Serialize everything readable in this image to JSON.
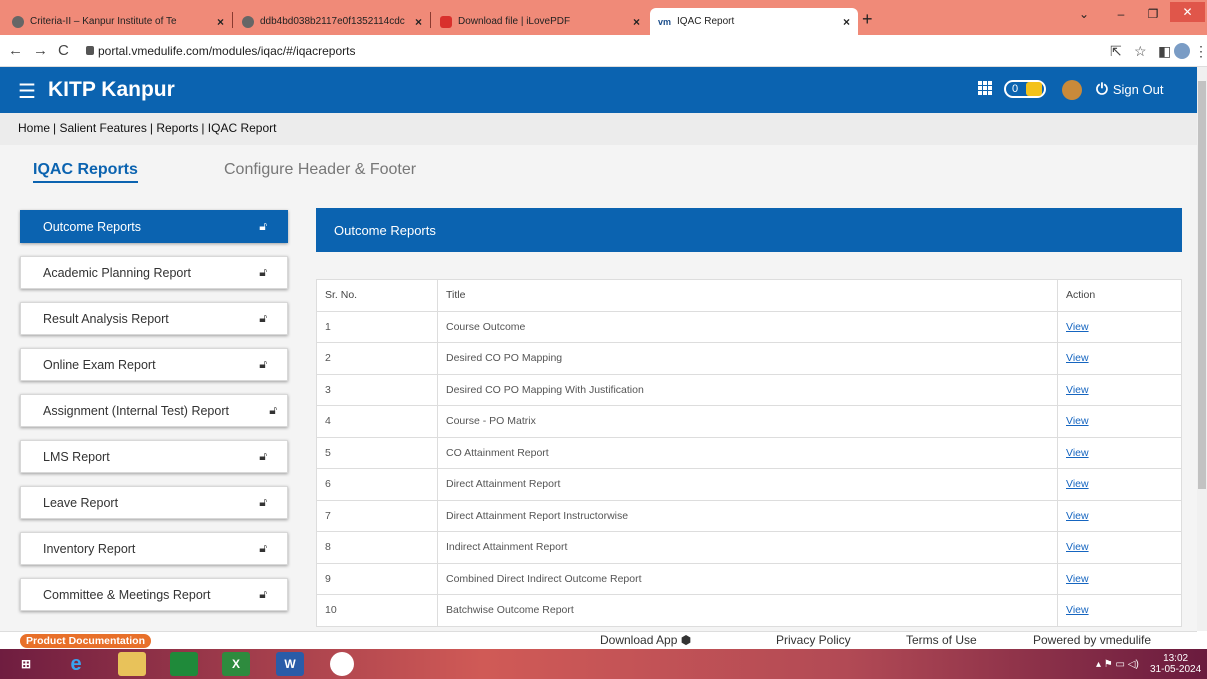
{
  "browser": {
    "tabs": [
      {
        "title": "Criteria-II – Kanpur Institute of Te"
      },
      {
        "title": "ddb4bd038b2117e0f1352114cdc"
      },
      {
        "title": "Download file | iLovePDF"
      },
      {
        "title": "IQAC Report"
      }
    ],
    "url": "portal.vmedulife.com/modules/iqac/#/iqacreports"
  },
  "header": {
    "brand": "KITP Kanpur",
    "trophy_count": "0",
    "signout_label": "Sign Out"
  },
  "breadcrumb": [
    "Home",
    "Salient Features",
    "Reports",
    "IQAC Report"
  ],
  "page_tabs": {
    "active": "IQAC Reports",
    "other": "Configure Header & Footer"
  },
  "menu": [
    {
      "label": "Outcome Reports"
    },
    {
      "label": "Academic Planning Report"
    },
    {
      "label": "Result Analysis Report"
    },
    {
      "label": "Online Exam Report"
    },
    {
      "label": "Assignment (Internal Test) Report"
    },
    {
      "label": "LMS Report"
    },
    {
      "label": "Leave Report"
    },
    {
      "label": "Inventory Report"
    },
    {
      "label": "Committee & Meetings Report"
    }
  ],
  "panel": {
    "title": "Outcome Reports",
    "columns": [
      "Sr. No.",
      "Title",
      "Action"
    ],
    "rows": [
      {
        "no": "1",
        "title": "Course Outcome",
        "action": "View"
      },
      {
        "no": "2",
        "title": "Desired CO PO Mapping",
        "action": "View"
      },
      {
        "no": "3",
        "title": "Desired CO PO Mapping With Justification",
        "action": "View"
      },
      {
        "no": "4",
        "title": "Course - PO Matrix",
        "action": "View"
      },
      {
        "no": "5",
        "title": "CO Attainment Report",
        "action": "View"
      },
      {
        "no": "6",
        "title": "Direct Attainment Report",
        "action": "View"
      },
      {
        "no": "7",
        "title": "Direct Attainment Report Instructorwise",
        "action": "View"
      },
      {
        "no": "8",
        "title": "Indirect Attainment Report",
        "action": "View"
      },
      {
        "no": "9",
        "title": "Combined Direct Indirect Outcome Report",
        "action": "View"
      },
      {
        "no": "10",
        "title": "Batchwise Outcome Report",
        "action": "View"
      }
    ]
  },
  "footer": {
    "product_doc": "Product Documentation",
    "download_app": "Download App",
    "privacy": "Privacy Policy",
    "terms": "Terms of Use",
    "powered": "Powered by vmedulife"
  },
  "taskbar": {
    "time": "13:02",
    "date": "31-05-2024"
  },
  "colors": {
    "primary": "#0b63b0",
    "tab_strip": "#f08a78",
    "doc_badge": "#e8702a"
  }
}
